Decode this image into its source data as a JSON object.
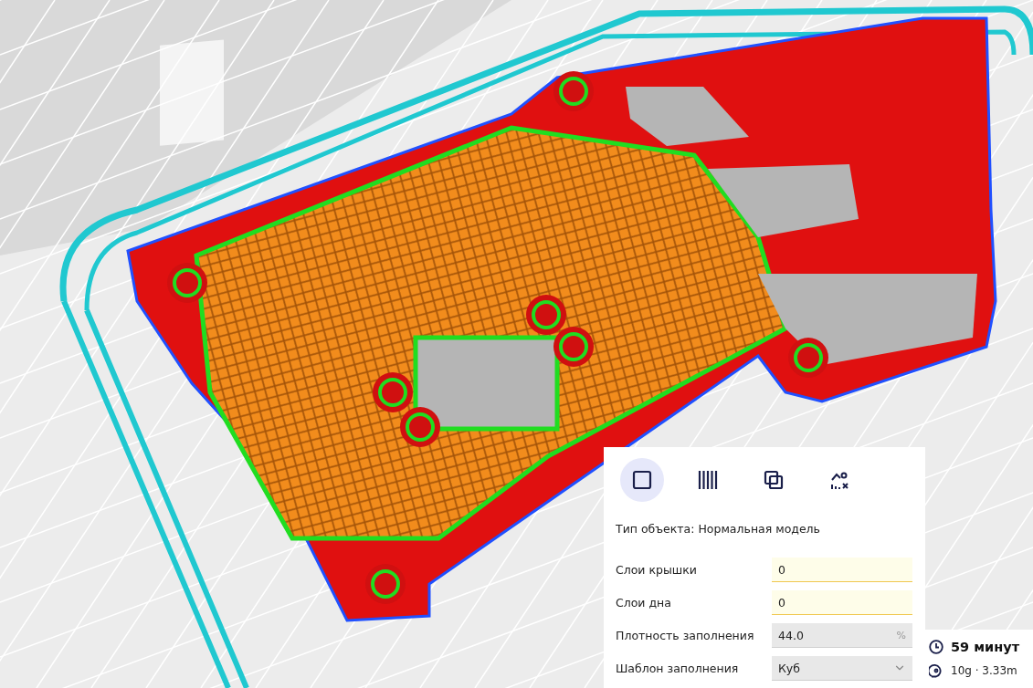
{
  "mesh_type_buttons": [
    {
      "kind": "normal",
      "selected": true
    },
    {
      "kind": "support",
      "selected": false
    },
    {
      "kind": "overlap",
      "selected": false
    },
    {
      "kind": "anti_overhang",
      "selected": false
    }
  ],
  "object_type": "Тип объекта: Нормальная модель",
  "settings": [
    {
      "kind": "input",
      "label": "Слои крышки",
      "value": "0",
      "modified": true
    },
    {
      "kind": "input",
      "label": "Слои дна",
      "value": "0",
      "modified": true
    },
    {
      "kind": "unit",
      "label": "Плотность заполнения",
      "value": "44.0",
      "unit": "%",
      "modified": false
    },
    {
      "kind": "select",
      "label": "Шаблон заполнения",
      "value": "Куб",
      "modified": false
    }
  ],
  "estimate": {
    "time": "59 минут",
    "material": "10g · 3.33m"
  }
}
